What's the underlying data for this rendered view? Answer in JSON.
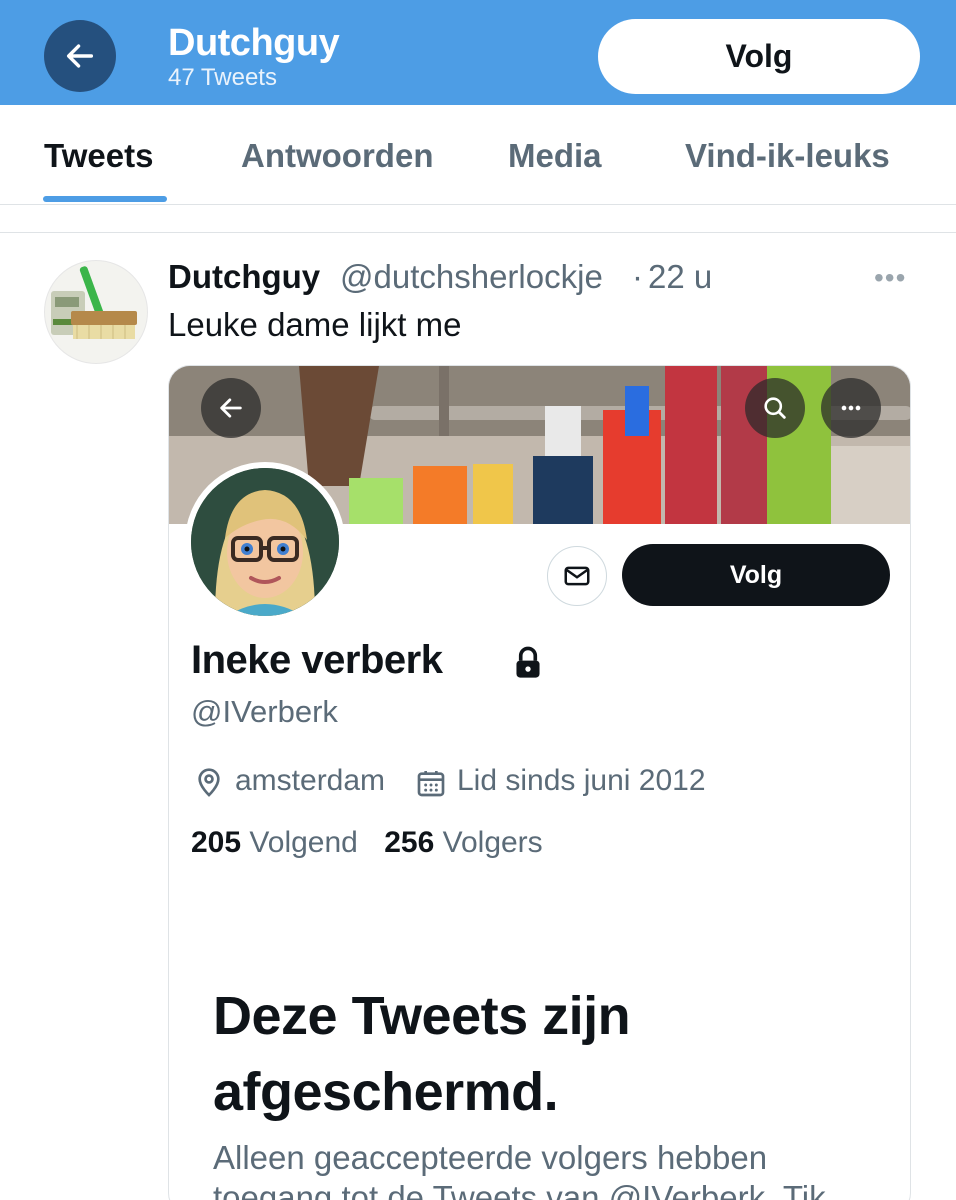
{
  "header": {
    "title": "Dutchguy",
    "tweet_count": "47 Tweets",
    "follow_label": "Volg",
    "accent": "#4d9de5"
  },
  "tabs": [
    {
      "label": "Tweets",
      "active": true
    },
    {
      "label": "Antwoorden",
      "active": false
    },
    {
      "label": "Media",
      "active": false
    },
    {
      "label": "Vind-ik-leuks",
      "active": false
    }
  ],
  "tweet": {
    "author_name": "Dutchguy",
    "author_handle": "@dutchsherlockje",
    "separator": "·",
    "time": "22 u",
    "more_icon": "more-horizontal-icon",
    "text": "Leuke dame lijkt me"
  },
  "embedded_profile": {
    "name": "Ineke verberk",
    "handle": "@IVerberk",
    "location": "amsterdam",
    "joined": "Lid sinds juni 2012",
    "following_count": "205",
    "following_label": "Volgend",
    "followers_count": "256",
    "followers_label": "Volgers",
    "follow_label": "Volg",
    "protected_title": "Deze Tweets zijn afgeschermd.",
    "protected_desc": "Alleen geaccepteerde volgers hebben toegang tot de Tweets van @IVerberk. Tik",
    "icons": [
      "back-arrow-icon",
      "search-icon",
      "more-icon",
      "mail-icon",
      "lock-icon",
      "location-pin-icon",
      "calendar-icon"
    ]
  }
}
